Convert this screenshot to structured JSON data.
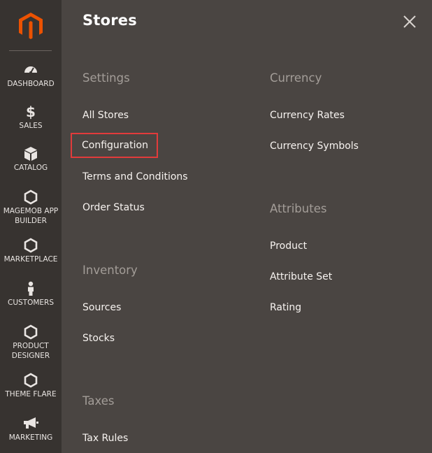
{
  "sidebar": {
    "items": [
      {
        "label": "DASHBOARD",
        "icon": "dashboard-icon"
      },
      {
        "label": "SALES",
        "icon": "dollar-icon"
      },
      {
        "label": "CATALOG",
        "icon": "box-icon"
      },
      {
        "label": "MAGEMOB APP BUILDER",
        "icon": "hexagon-icon"
      },
      {
        "label": "MARKETPLACE",
        "icon": "hexagon-icon"
      },
      {
        "label": "CUSTOMERS",
        "icon": "person-icon"
      },
      {
        "label": "PRODUCT DESIGNER",
        "icon": "hexagon-icon"
      },
      {
        "label": "THEME FLARE",
        "icon": "hexagon-icon"
      },
      {
        "label": "MARKETING",
        "icon": "megaphone-icon"
      }
    ],
    "dollar_glyph": "$"
  },
  "panel": {
    "title": "Stores",
    "sections": {
      "settings": {
        "title": "Settings",
        "links": [
          "All Stores",
          "Configuration",
          "Terms and Conditions",
          "Order Status"
        ]
      },
      "inventory": {
        "title": "Inventory",
        "links": [
          "Sources",
          "Stocks"
        ]
      },
      "taxes": {
        "title": "Taxes",
        "links": [
          "Tax Rules"
        ]
      },
      "currency": {
        "title": "Currency",
        "links": [
          "Currency Rates",
          "Currency Symbols"
        ]
      },
      "attributes": {
        "title": "Attributes",
        "links": [
          "Product",
          "Attribute Set",
          "Rating"
        ]
      }
    }
  },
  "colors": {
    "sidebar_bg": "#373330",
    "panel_bg": "#4a4542",
    "brand_orange": "#eb5202",
    "highlight_red": "#e23b3b",
    "section_title": "#a39d98"
  }
}
